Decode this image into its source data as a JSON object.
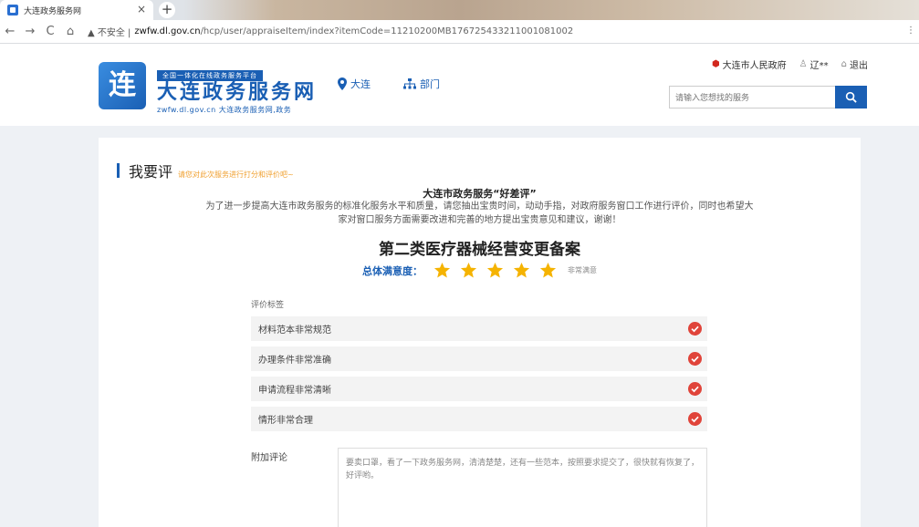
{
  "browser": {
    "tab_title": "大连政务服务网",
    "tab_close": "×",
    "new_tab": "+",
    "security_label": "▲ 不安全 |",
    "url_host": "zwfw.dl.gov.cn",
    "url_path": "/hcp/user/appraiseItem/index?itemCode=11210200MB1767254332110010810​02",
    "menu_icon": "⋮"
  },
  "header": {
    "tagline": "全国一体化在线政务服务平台",
    "site_name": "大连政务服务网",
    "site_sub": "zwfw.dl.gov.cn  大连政务服务网,政务",
    "logo_char": "连",
    "location": "大连",
    "department": "部门",
    "gov_link": "大连市人民政府",
    "user": "辽**",
    "logout": "退出",
    "search_placeholder": "请输入您想找的服务"
  },
  "main": {
    "section_title": "我要评",
    "section_hint": "请您对此次服务进行打分和评价吧~",
    "intro_title": "大连市政务服务“好差评”",
    "intro_text": "为了进一步提高大连市政务服务的标准化服务水平和质量，请您抽出宝贵时间，动动手指，对政府服务窗口工作进行评价，同时也希望大家对窗口服务方面需要改进和完善的地方提出宝贵意见和建议，谢谢！",
    "item_title": "第二类医疗器械经营变更备案",
    "overall_label": "总体满意度：",
    "rating": 5,
    "rating_max": 5,
    "rating_text": "非常满意",
    "tags_label": "评价标签",
    "tags": [
      {
        "label": "材料范本非常规范",
        "checked": true
      },
      {
        "label": "办理条件非常准确",
        "checked": true
      },
      {
        "label": "申请流程非常清晰",
        "checked": true
      },
      {
        "label": "情形非常合理",
        "checked": true
      }
    ],
    "comment_label": "附加评论",
    "comment_value": "要卖口罩，看了一下政务服务网，清清楚楚，还有一些范本，按照要求提交了，很快就有恢复了，好评哟。"
  },
  "colors": {
    "brand": "#1a5fb4",
    "star": "#f5b301",
    "check": "#e0443a",
    "hint": "#f0a030"
  }
}
